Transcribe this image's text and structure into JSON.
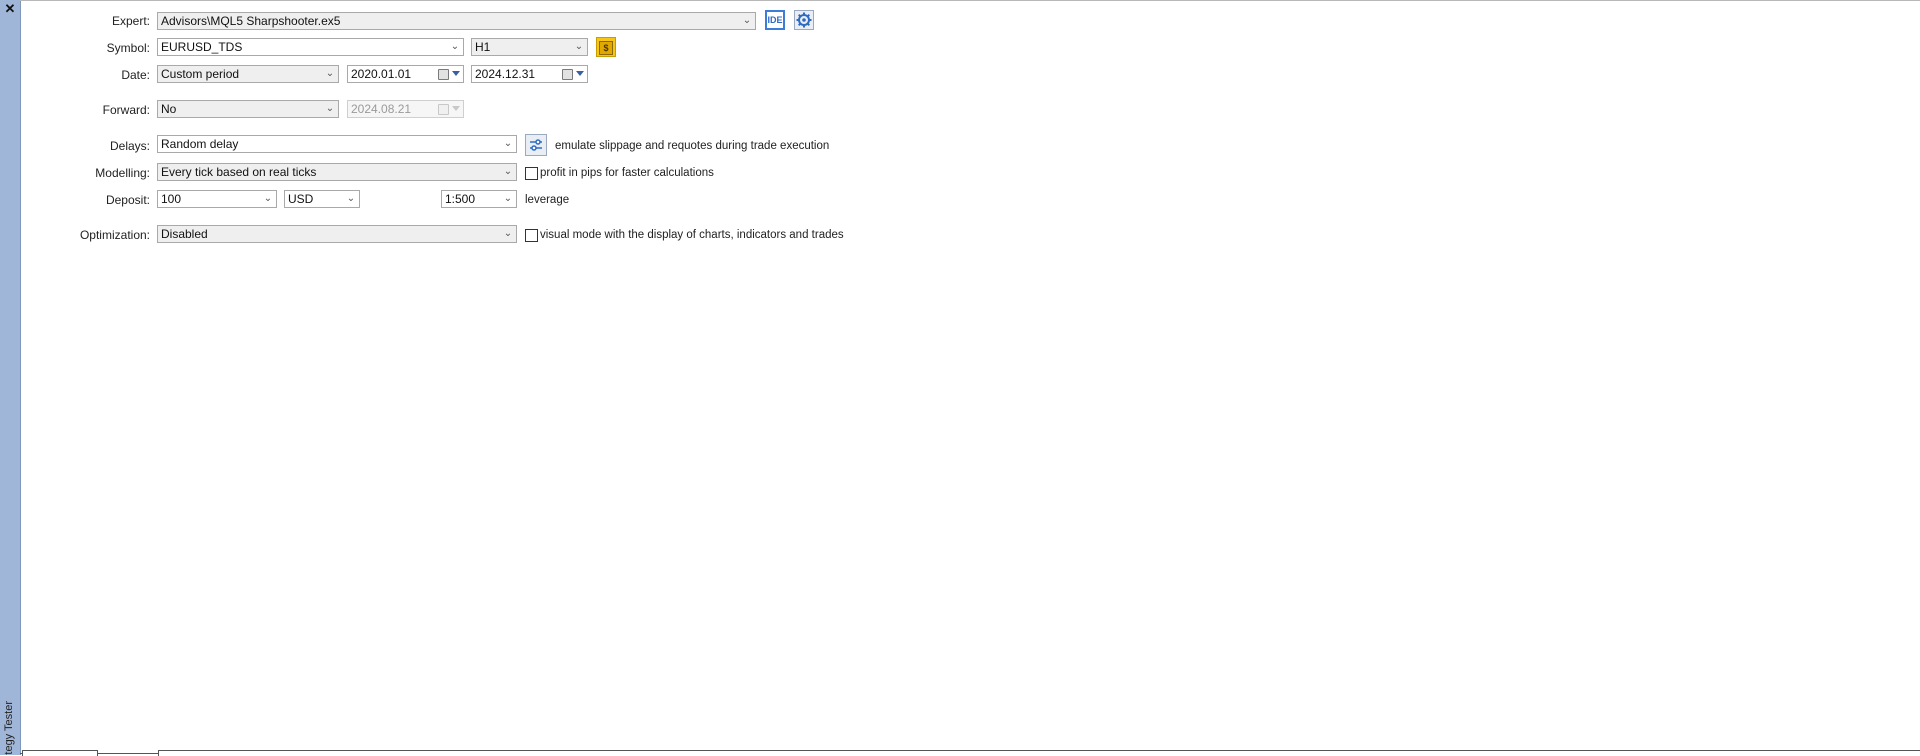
{
  "panel": {
    "title_fragment": "tegy Tester",
    "close_glyph": "✕"
  },
  "form": {
    "expert": {
      "label": "Expert:",
      "value": "Advisors\\MQL5 Sharpshooter.ex5",
      "ide_label": "IDE"
    },
    "symbol": {
      "label": "Symbol:",
      "value": "EURUSD_TDS",
      "timeframe": "H1",
      "dollar_glyph": "$"
    },
    "date": {
      "label": "Date:",
      "period": "Custom period",
      "from": "2020.01.01",
      "to": "2024.12.31"
    },
    "forward": {
      "label": "Forward:",
      "value": "No",
      "date": "2024.08.21"
    },
    "delays": {
      "label": "Delays:",
      "value": "Random delay",
      "note": "emulate slippage and requotes during trade execution"
    },
    "modelling": {
      "label": "Modelling:",
      "value": "Every tick based on real ticks",
      "checkbox_label": "profit in pips for faster calculations",
      "checked": false
    },
    "deposit": {
      "label": "Deposit:",
      "amount": "100",
      "currency": "USD",
      "leverage_value": "1:500",
      "leverage_label": "leverage"
    },
    "optimization": {
      "label": "Optimization:",
      "value": "Disabled",
      "checkbox_label": "visual mode with the display of charts, indicators and trades",
      "checked": false
    }
  },
  "icons": {
    "close": "close-icon",
    "settings": "gear-icon",
    "delays_settings": "sliders-icon",
    "symbol_properties": "dollar-icon",
    "calendar": "calendar-icon",
    "dropdown": "chevron-down-icon"
  },
  "colors": {
    "side_strip": "#9fb6d8",
    "ide_accent": "#3b7dd8",
    "dollar": "#f5c518"
  }
}
